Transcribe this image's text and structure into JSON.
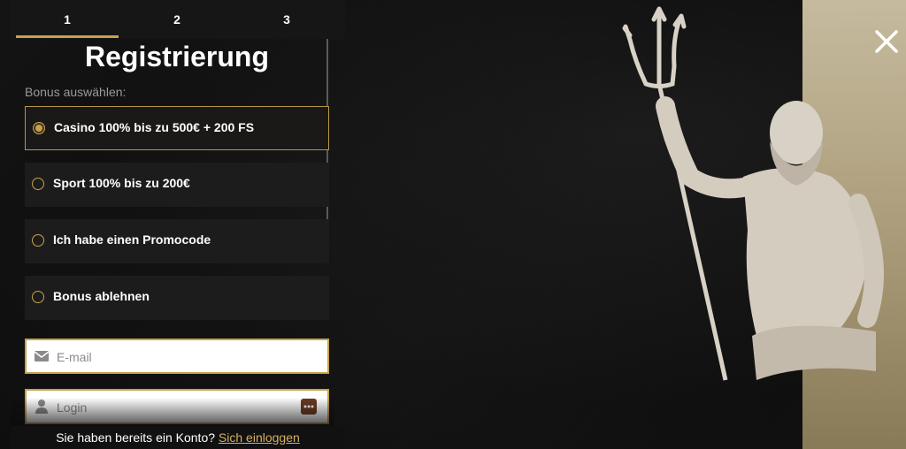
{
  "stepper": {
    "steps": [
      {
        "label": "1",
        "active": true
      },
      {
        "label": "2",
        "active": false
      },
      {
        "label": "3",
        "active": false
      }
    ]
  },
  "form": {
    "title": "Registrierung",
    "bonus_label": "Bonus auswählen:",
    "options": [
      {
        "label": "Casino 100% bis zu 500€ + 200 FS",
        "selected": true
      },
      {
        "label": "Sport 100% bis zu 200€",
        "selected": false
      },
      {
        "label": "Ich habe einen Promocode",
        "selected": false
      },
      {
        "label": "Bonus ablehnen",
        "selected": false
      }
    ],
    "email": {
      "placeholder": "E-mail",
      "value": "",
      "icon": "envelope-icon"
    },
    "login": {
      "placeholder": "Login",
      "value": "",
      "icon": "user-icon",
      "action_icon": "password-generator-icon"
    }
  },
  "footer": {
    "text": "Sie haben bereits ein Konto?",
    "link": "Sich einloggen"
  },
  "colors": {
    "accent": "#c8a24a",
    "background": "#0b0b0b",
    "option_bg": "#1c1c1c",
    "link": "#d6b062"
  },
  "close_icon": "close-icon"
}
